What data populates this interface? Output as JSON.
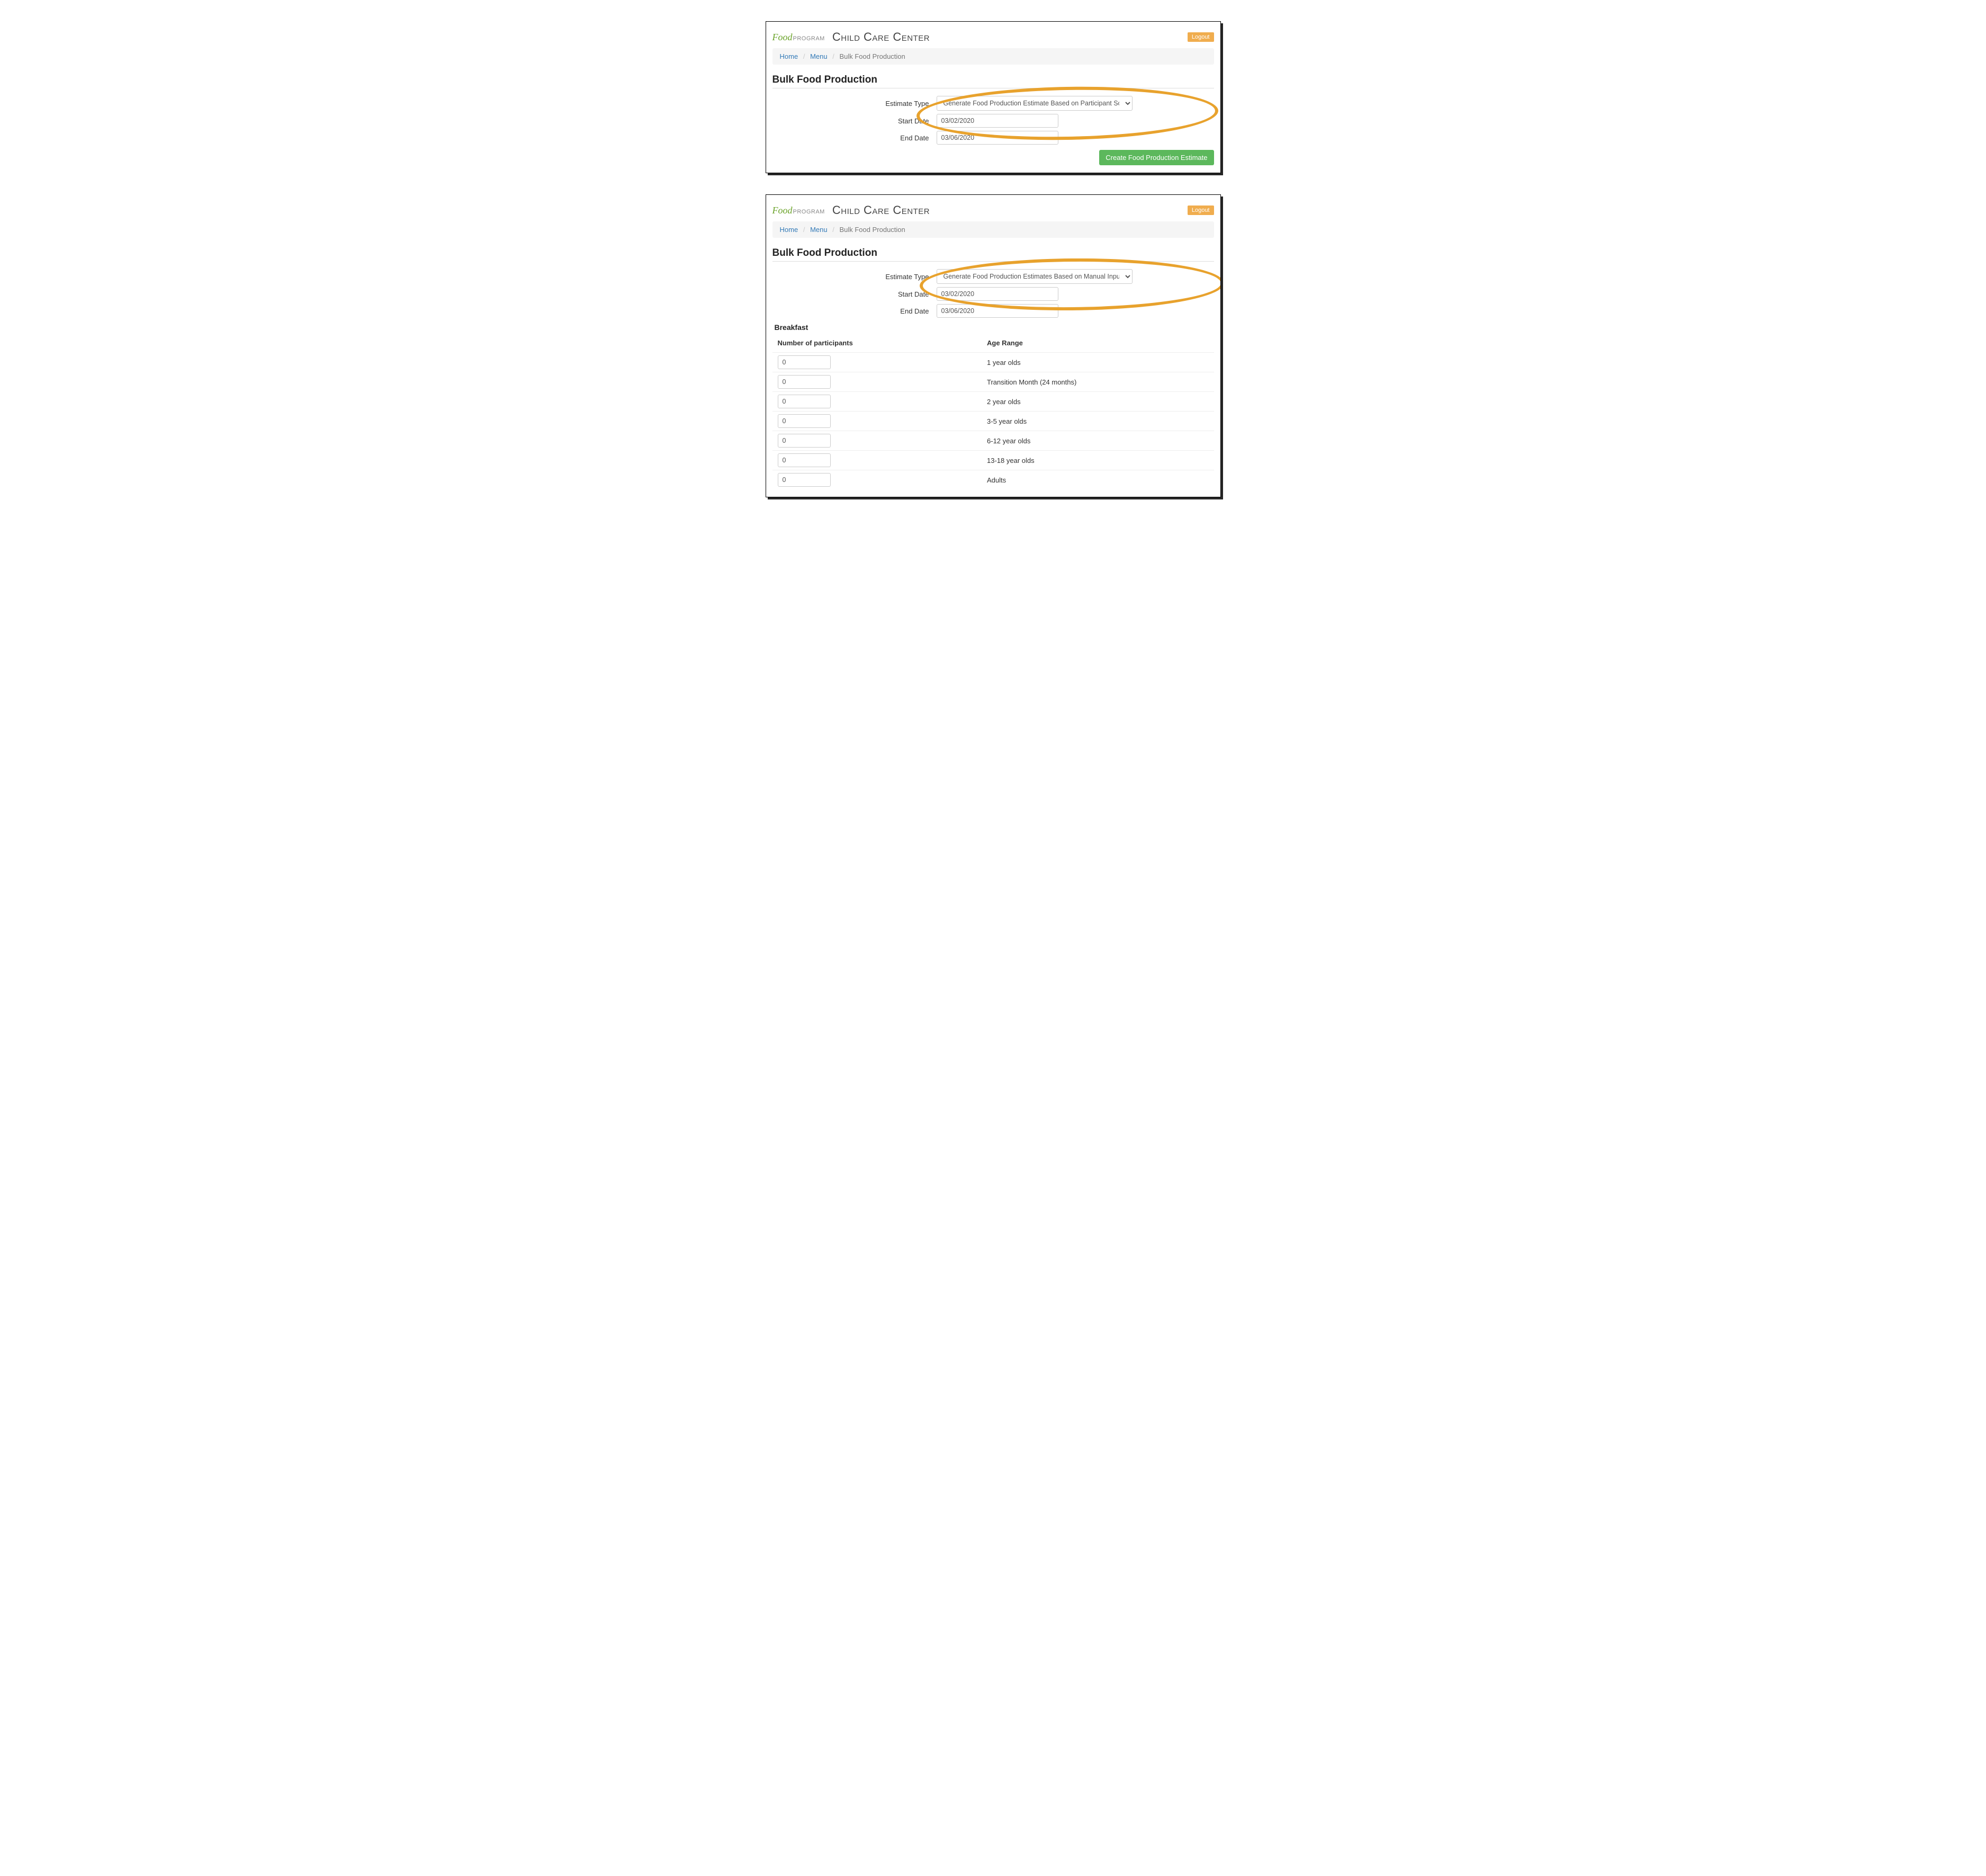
{
  "logo": {
    "food": "Food",
    "program": "PROGRAM"
  },
  "app_title": "Child Care Center",
  "logout_label": "Logout",
  "breadcrumb": {
    "home": "Home",
    "menu": "Menu",
    "current": "Bulk Food Production"
  },
  "page_title": "Bulk Food Production",
  "panel1": {
    "estimate_type_label": "Estimate Type",
    "estimate_type_value": "Generate Food Production Estimate Based on Participant Schedule",
    "start_date_label": "Start Date",
    "start_date_value": "03/02/2020",
    "end_date_label": "End Date",
    "end_date_value": "03/06/2020",
    "create_button": "Create Food Production Estimate"
  },
  "panel2": {
    "estimate_type_label": "Estimate Type",
    "estimate_type_value": "Generate Food Production Estimates Based on Manual Inputs",
    "start_date_label": "Start Date",
    "start_date_value": "03/02/2020",
    "end_date_label": "End Date",
    "end_date_value": "03/06/2020",
    "meal_section": "Breakfast",
    "col_participants": "Number of participants",
    "col_age": "Age Range",
    "rows": [
      {
        "value": "0",
        "label": "1 year olds"
      },
      {
        "value": "0",
        "label": "Transition Month (24 months)"
      },
      {
        "value": "0",
        "label": "2 year olds"
      },
      {
        "value": "0",
        "label": "3-5 year olds"
      },
      {
        "value": "0",
        "label": "6-12 year olds"
      },
      {
        "value": "0",
        "label": "13-18 year olds"
      },
      {
        "value": "0",
        "label": "Adults"
      }
    ]
  }
}
